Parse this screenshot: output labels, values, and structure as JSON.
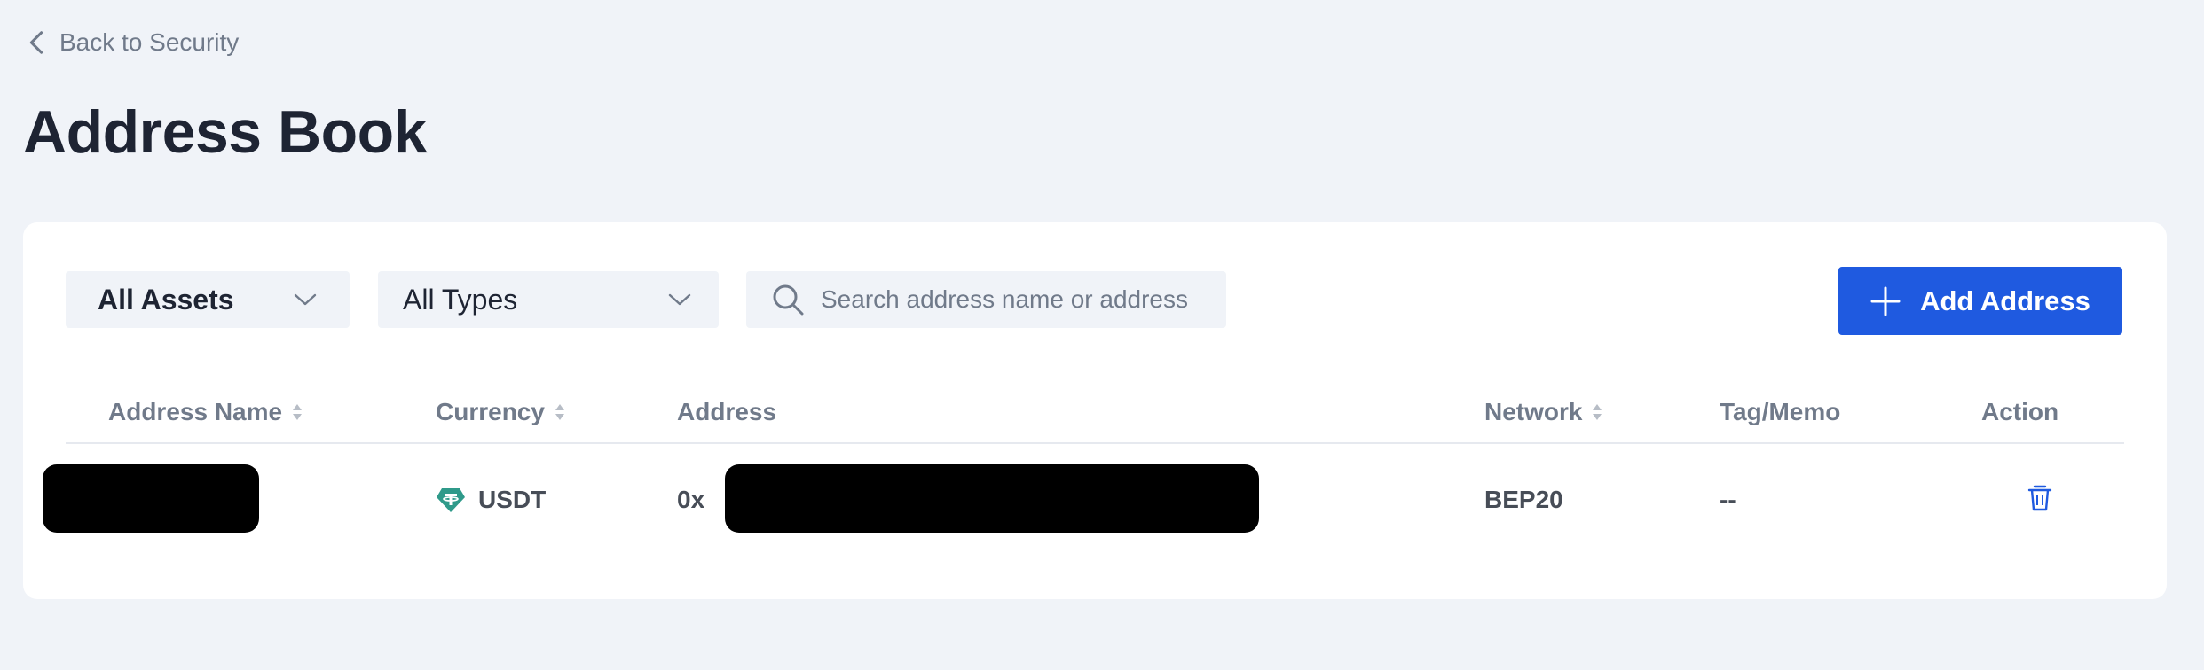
{
  "header": {
    "back_label": "Back to Security",
    "title": "Address Book"
  },
  "filters": {
    "assets_label": "All Assets",
    "types_label": "All Types",
    "search_placeholder": "Search address name or address",
    "search_value": ""
  },
  "actions": {
    "add_address_label": "Add Address"
  },
  "table": {
    "columns": {
      "name": "Address Name",
      "currency": "Currency",
      "address": "Address",
      "network": "Network",
      "tag": "Tag/Memo",
      "action": "Action"
    },
    "rows": [
      {
        "currency": "USDT",
        "address_prefix": "0x",
        "network": "BEP20",
        "tag": "--"
      }
    ]
  },
  "colors": {
    "accent": "#1f5ae0",
    "background": "#f0f3f8",
    "tether": "#2f9a8a"
  },
  "icons": {
    "back": "chevron-left-icon",
    "dropdown": "chevron-down-icon",
    "search": "search-icon",
    "add": "plus-icon",
    "sort": "sort-icon",
    "currency": "tether-icon",
    "delete": "trash-icon"
  }
}
